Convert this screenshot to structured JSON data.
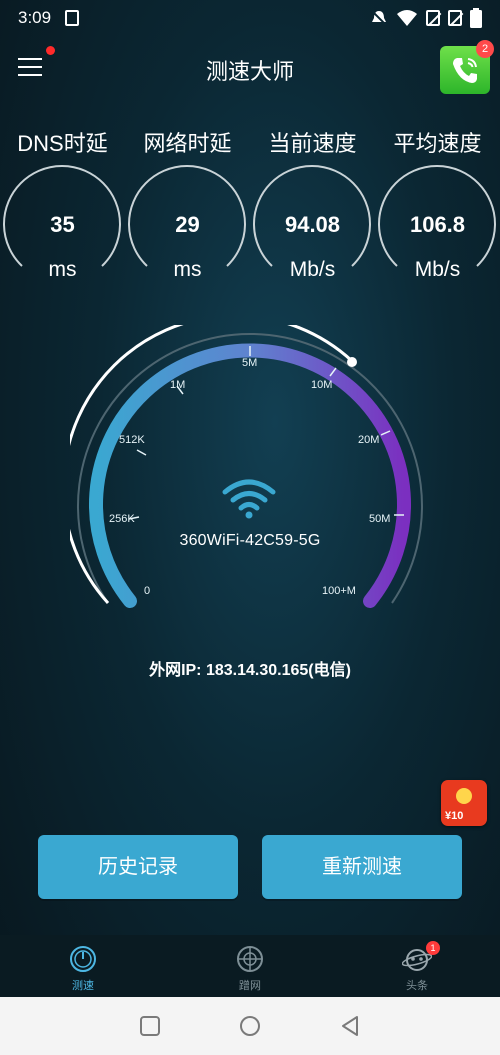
{
  "status": {
    "time": "3:09"
  },
  "appbar": {
    "title": "测速大师",
    "call_badge": "2"
  },
  "metrics": [
    {
      "label": "DNS时延",
      "value": "35",
      "unit": "ms"
    },
    {
      "label": "网络时延",
      "value": "29",
      "unit": "ms"
    },
    {
      "label": "当前速度",
      "value": "94.08",
      "unit": "Mb/s"
    },
    {
      "label": "平均速度",
      "value": "106.8",
      "unit": "Mb/s"
    }
  ],
  "gauge": {
    "labels": [
      "0",
      "256K",
      "512K",
      "1M",
      "5M",
      "10M",
      "20M",
      "50M",
      "100+M"
    ],
    "ssid": "360WiFi-42C59-5G"
  },
  "public_ip": "外网IP: 183.14.30.165(电信)",
  "reward": {
    "text": "¥10"
  },
  "buttons": {
    "history": "历史记录",
    "retest": "重新测速"
  },
  "tabs": [
    {
      "label": "测速",
      "active": true
    },
    {
      "label": "蹭网",
      "active": false
    },
    {
      "label": "头条",
      "active": false,
      "badge": "1"
    }
  ],
  "colors": {
    "accent": "#3aa8d1",
    "gauge_start": "#3aa8d1",
    "gauge_end": "#7b2fc0",
    "badge": "#ff2a2a"
  }
}
